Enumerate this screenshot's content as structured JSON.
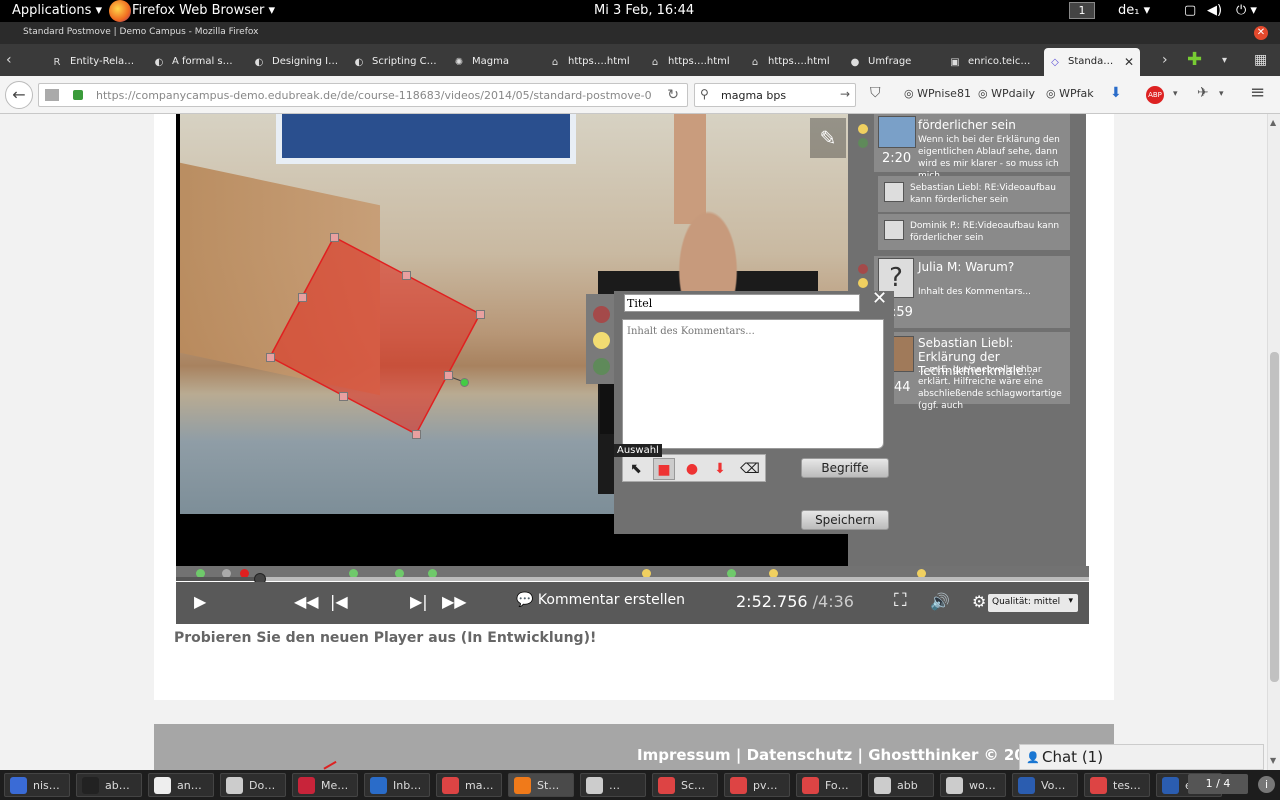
{
  "top_bar": {
    "applications": "Applications",
    "app_name": "Firefox Web Browser",
    "clock": "Mi 3 Feb, 16:44",
    "workspace": "1",
    "keyboard": "de₁"
  },
  "window": {
    "title": "Standard Postmove | Demo Campus - Mozilla Firefox"
  },
  "tabs": [
    {
      "label": "Entity-Rela…",
      "icon": "R"
    },
    {
      "label": "A formal s…",
      "icon": "◐"
    },
    {
      "label": "Designing I…",
      "icon": "◐"
    },
    {
      "label": "Scripting C…",
      "icon": "◐"
    },
    {
      "label": "Magma",
      "icon": "✺"
    },
    {
      "label": "https….html",
      "icon": "⌂"
    },
    {
      "label": "https….html",
      "icon": "⌂"
    },
    {
      "label": "https….html",
      "icon": "⌂"
    },
    {
      "label": "Umfrage",
      "icon": "●"
    },
    {
      "label": "enrico.teic…",
      "icon": "▣"
    },
    {
      "label": "Standa…",
      "icon": "◇",
      "active": true
    }
  ],
  "nav": {
    "url": "https://companycampus-demo.edubreak.de/de/course-118683/videos/2014/05/standard-postmove-0",
    "search_value": "magma bps",
    "bookmarks": [
      "WPnise81",
      "WPdaily",
      "WPfak"
    ]
  },
  "comments": [
    {
      "title": "förderlicher sein",
      "body": "Wenn ich bei der Erklärung den eigentlichen Ablauf sehe, dann wird es mir klarer - so muss ich mich",
      "time": "2:20"
    },
    {
      "reply": "Sebastian Liebl: RE:Videoaufbau kann förderlicher sein"
    },
    {
      "reply": "Dominik P.: RE:Videoaufbau kann förderlicher sein"
    },
    {
      "title": "Julia M: Warum?",
      "body": "Inhalt des Kommentars...",
      "time": ":59"
    },
    {
      "title": "Sebastian Liebl: Erklärung der Technikmerkmale...",
      "body": "... m.E. gut/nachvollziehbar erklärt. Hilfreiche wäre eine abschließende schlagwortartige (ggf. auch",
      "time": "44"
    }
  ],
  "editor": {
    "title_value": "Titel",
    "body_placeholder": "Inhalt des Kommentars...",
    "tooltip": "Auswahl",
    "terms_button": "Begriffe",
    "save_button": "Speichern",
    "colors": {
      "red": "#a44a4a",
      "yellow": "#f2dc72",
      "green": "#5f8a5a"
    }
  },
  "markers": [
    {
      "color": "#6fc96b",
      "pos": 0.022
    },
    {
      "color": "#aaaaaa",
      "pos": 0.05
    },
    {
      "color": "#e02020",
      "pos": 0.07
    },
    {
      "color": "#6fc96b",
      "pos": 0.19
    },
    {
      "color": "#6fc96b",
      "pos": 0.24
    },
    {
      "color": "#6fc96b",
      "pos": 0.276
    },
    {
      "color": "#f0d060",
      "pos": 0.51
    },
    {
      "color": "#6fc96b",
      "pos": 0.604
    },
    {
      "color": "#f0d060",
      "pos": 0.65
    },
    {
      "color": "#f0d060",
      "pos": 0.812
    }
  ],
  "player": {
    "progress": 0.092,
    "comment_label": "Kommentar erstellen",
    "current_time": "2:52.756",
    "duration": "/4:36",
    "quality": "Qualität: mittel"
  },
  "page": {
    "promo": "Probieren Sie den neuen Player aus (In Entwicklung)!",
    "footer_links": "Impressum | Datenschutz | Ghostthinker © 2005",
    "chat": "Chat (1)"
  },
  "taskbar": {
    "items": [
      {
        "label": "nis…",
        "color": "#3a6bd6"
      },
      {
        "label": "ab…",
        "color": "#222"
      },
      {
        "label": "an…",
        "color": "#eee"
      },
      {
        "label": "Do…",
        "color": "#ccc"
      },
      {
        "label": "Me…",
        "color": "#c8243a"
      },
      {
        "label": "Inb…",
        "color": "#2a6cc9"
      },
      {
        "label": "ma…",
        "color": "#d44"
      },
      {
        "label": "St…",
        "color": "#f07a1a",
        "active": true
      },
      {
        "label": "…",
        "color": "#ccc"
      },
      {
        "label": "Sc…",
        "color": "#d44"
      },
      {
        "label": "pv…",
        "color": "#d44"
      },
      {
        "label": "Fo…",
        "color": "#d44"
      },
      {
        "label": "abb",
        "color": "#ccc"
      },
      {
        "label": "wo…",
        "color": "#ccc"
      },
      {
        "label": "Vo…",
        "color": "#2b5db0"
      },
      {
        "label": "tes…",
        "color": "#d44"
      },
      {
        "label": "ee…",
        "color": "#2b5db0"
      }
    ],
    "pager": "1 / 4"
  }
}
